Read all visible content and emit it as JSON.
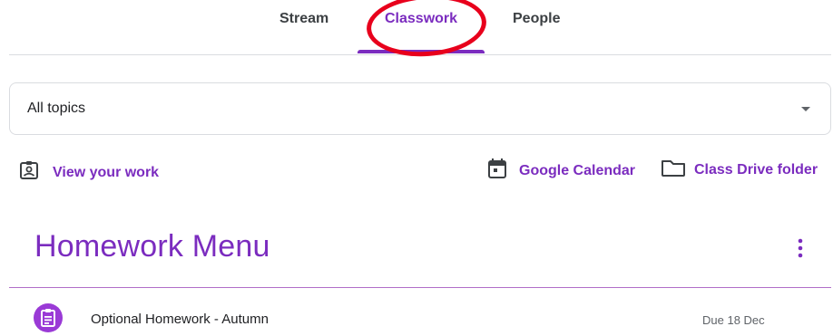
{
  "tabs": [
    {
      "label": "Stream",
      "active": false
    },
    {
      "label": "Classwork",
      "active": true
    },
    {
      "label": "People",
      "active": false
    }
  ],
  "topic_filter": {
    "selected": "All topics"
  },
  "links": {
    "view_work": "View your work",
    "calendar": "Google Calendar",
    "drive": "Class Drive folder"
  },
  "section": {
    "title": "Homework Menu"
  },
  "assignments": [
    {
      "title": "Optional Homework - Autumn",
      "due": "Due 18 Dec",
      "icon": "assignment-icon"
    }
  ],
  "colors": {
    "accent": "#7b2cbf",
    "annotation": "#e8001c",
    "assignment_icon_bg": "#9a3ad6"
  },
  "icons": [
    "assignment-ind-icon",
    "calendar-icon",
    "folder-icon",
    "more-vert-icon",
    "assignment-icon",
    "dropdown-arrow-icon"
  ]
}
